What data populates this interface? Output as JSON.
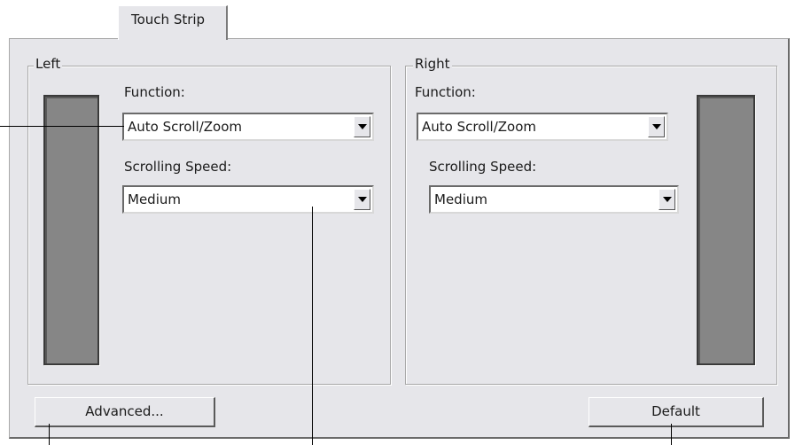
{
  "tab": {
    "label": "Touch Strip"
  },
  "left_group": {
    "title": "Left",
    "function_label": "Function:",
    "function_value": "Auto Scroll/Zoom",
    "speed_label": "Scrolling Speed:",
    "speed_value": "Medium"
  },
  "right_group": {
    "title": "Right",
    "function_label": "Function:",
    "function_value": "Auto Scroll/Zoom",
    "speed_label": "Scrolling Speed:",
    "speed_value": "Medium"
  },
  "buttons": {
    "advanced": "Advanced...",
    "default": "Default"
  },
  "icons": {
    "dropdown": "chevron-down-icon"
  },
  "colors": {
    "panel_bg": "#e6e6ea",
    "strip": "#868686",
    "callout": "#000000"
  }
}
